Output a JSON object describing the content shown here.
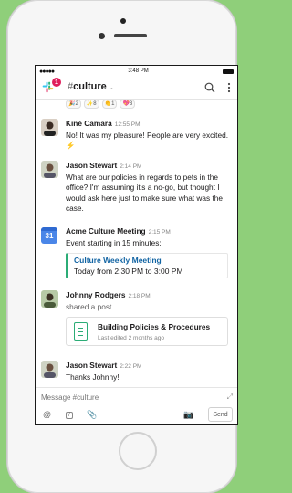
{
  "status_bar": {
    "signal": "●●●●●",
    "time": "3:48 PM"
  },
  "header": {
    "badge_count": "1",
    "channel_hash": "#",
    "channel_name": "culture",
    "chevron": "⌄",
    "search_icon": "search-icon",
    "more_icon": "more-vertical-icon"
  },
  "reactions": [
    {
      "label": "🎉2"
    },
    {
      "label": "✨8"
    },
    {
      "label": "👏1"
    },
    {
      "label": "💖3"
    }
  ],
  "messages": {
    "kine": {
      "author": "Kiné Camara",
      "time": "12:55 PM",
      "text": "No! It was my pleasure! People are very excited.",
      "emoji": "⚡"
    },
    "jason1": {
      "author": "Jason Stewart",
      "time": "2:14 PM",
      "text": "What are our policies in regards to pets in the office? I'm assuming it's a no-go, but thought I would ask here just to make sure what was the case."
    },
    "meeting": {
      "author": "Acme Culture Meeting",
      "time": "2:15 PM",
      "text": "Event starting in 15 minutes:",
      "calendar_day": "31",
      "event_title": "Culture Weekly Meeting",
      "event_time": "Today from 2:30 PM to 3:00 PM"
    },
    "johnny": {
      "author": "Johnny Rodgers",
      "time": "2:18 PM",
      "sub": "shared a post",
      "post_title": "Building Policies & Procedures",
      "post_sub": "Last edited 2 months ago"
    },
    "jason2": {
      "author": "Jason Stewart",
      "time": "2:22 PM",
      "text": "Thanks Johnny!"
    }
  },
  "composer": {
    "placeholder": "Message #culture",
    "send_label": "Send",
    "tools": [
      "@",
      "/",
      "📎",
      "📷"
    ]
  },
  "colors": {
    "accent_link": "#1264a3",
    "green": "#2bac76",
    "badge": "#e01e5a",
    "background": "#8fcf7a"
  }
}
